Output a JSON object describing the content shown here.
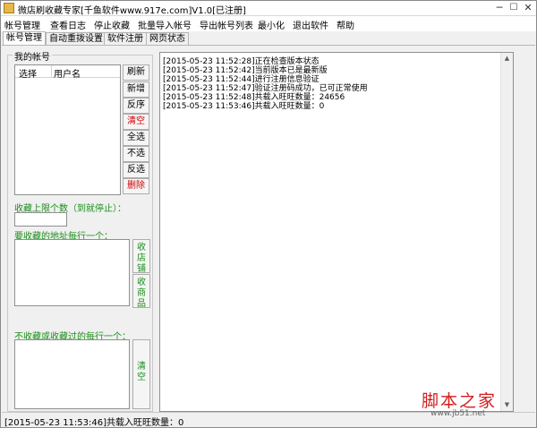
{
  "window": {
    "title": "微店刷收藏专家[千鱼软件www.917e.com]V1.0[已注册]",
    "min_icon": "minimize-icon",
    "max_icon": "maximize-icon",
    "close_icon": "close-icon"
  },
  "menu": {
    "items": [
      "帐号管理",
      "查看日志",
      "停止收藏",
      "批量导入帐号",
      "导出帐号列表",
      "最小化",
      "退出软件",
      "帮助"
    ]
  },
  "tabs": [
    "帐号管理",
    "自动重拨设置",
    "软件注册",
    "网页状态"
  ],
  "account_panel": {
    "group_title": "我的帐号",
    "columns": [
      "选择",
      "用户名"
    ],
    "buttons": [
      "刷新",
      "新增",
      "反序",
      "清空",
      "全选",
      "不选",
      "反选",
      "删除"
    ],
    "red_buttons": [
      "清空",
      "删除"
    ]
  },
  "limit_label": "收藏上限个数（到就停止）：",
  "limit_value": "",
  "address_label": "要收藏的地址每行一个：",
  "collect_shop_button": "收店铺",
  "collect_goods_button": "收商品",
  "exclude_label": "不收藏或收藏过的每行一个：",
  "clear_button": "清空",
  "log": {
    "lines": [
      "[2015-05-23 11:52:28]正在检查版本状态",
      "[2015-05-23 11:52:42]当前版本已是最新版",
      "[2015-05-23 11:52:44]进行注册信息验证",
      "[2015-05-23 11:52:47]验证注册码成功，已可正常使用",
      "[2015-05-23 11:52:48]共载入旺旺数量：24656",
      "[2015-05-23 11:53:46]共载入旺旺数量：0"
    ]
  },
  "status": {
    "text": "[2015-05-23 11:53:46]共载入旺旺数量：0"
  },
  "watermark": {
    "main": "脚本之家",
    "sub": "www.jb51.net"
  },
  "colors": {
    "accent_green": "#1a8f1a",
    "danger_red": "#d00000",
    "watermark_red": "#d11e1e"
  }
}
